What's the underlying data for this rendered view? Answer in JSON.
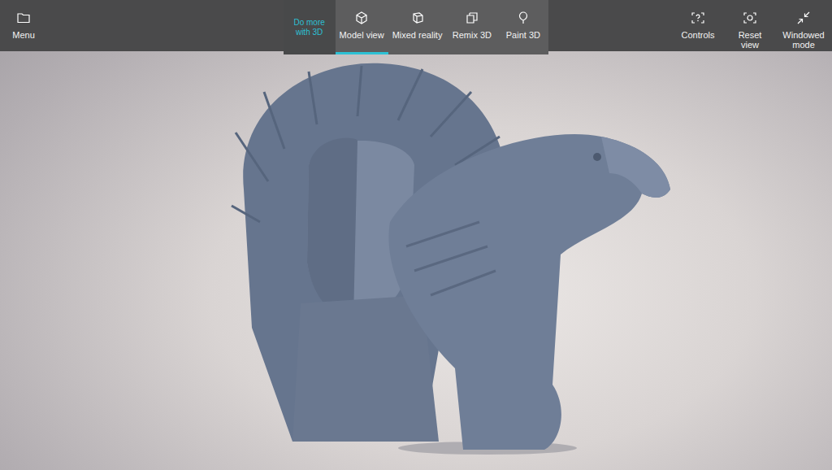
{
  "app_bar": {
    "menu": {
      "label": "Menu"
    },
    "promo": {
      "label": "Do more with 3D"
    },
    "tabs": [
      {
        "label": "Model view",
        "selected": true
      },
      {
        "label": "Mixed reality",
        "selected": false
      },
      {
        "label": "Remix 3D",
        "selected": false
      },
      {
        "label": "Paint 3D",
        "selected": false
      }
    ],
    "actions": [
      {
        "label": "Controls"
      },
      {
        "label": "Reset view"
      },
      {
        "label": "Windowed mode"
      }
    ]
  }
}
